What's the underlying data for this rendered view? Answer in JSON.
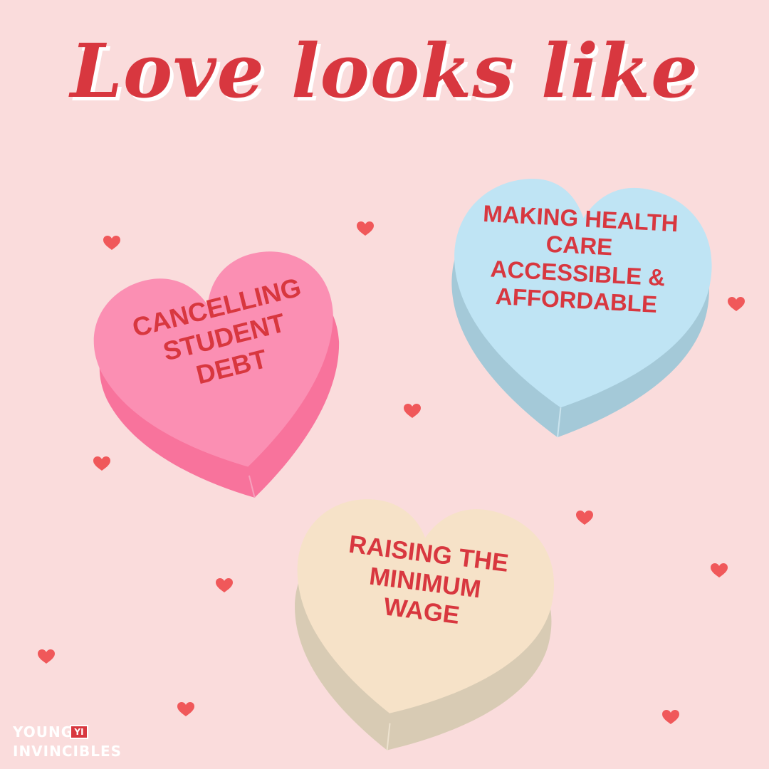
{
  "title": "Love looks like",
  "hearts": [
    {
      "lines": [
        "CANCELLING",
        "STUDENT",
        "DEBT"
      ]
    },
    {
      "lines": [
        "MAKING HEALTH",
        "CARE",
        "ACCESSIBLE &",
        "AFFORDABLE"
      ]
    },
    {
      "lines": [
        "RAISING THE",
        "MINIMUM",
        "WAGE"
      ]
    }
  ],
  "logo": {
    "line1": "YOUNG",
    "badge": "YI",
    "line2": "INVINCIBLES"
  },
  "colors": {
    "background": "#fadcdc",
    "text_red": "#d8373f",
    "pink_heart": "#fb8fb3",
    "blue_heart": "#bfe4f4",
    "cream_heart": "#f6e2c8",
    "small_heart": "#f0585a"
  }
}
